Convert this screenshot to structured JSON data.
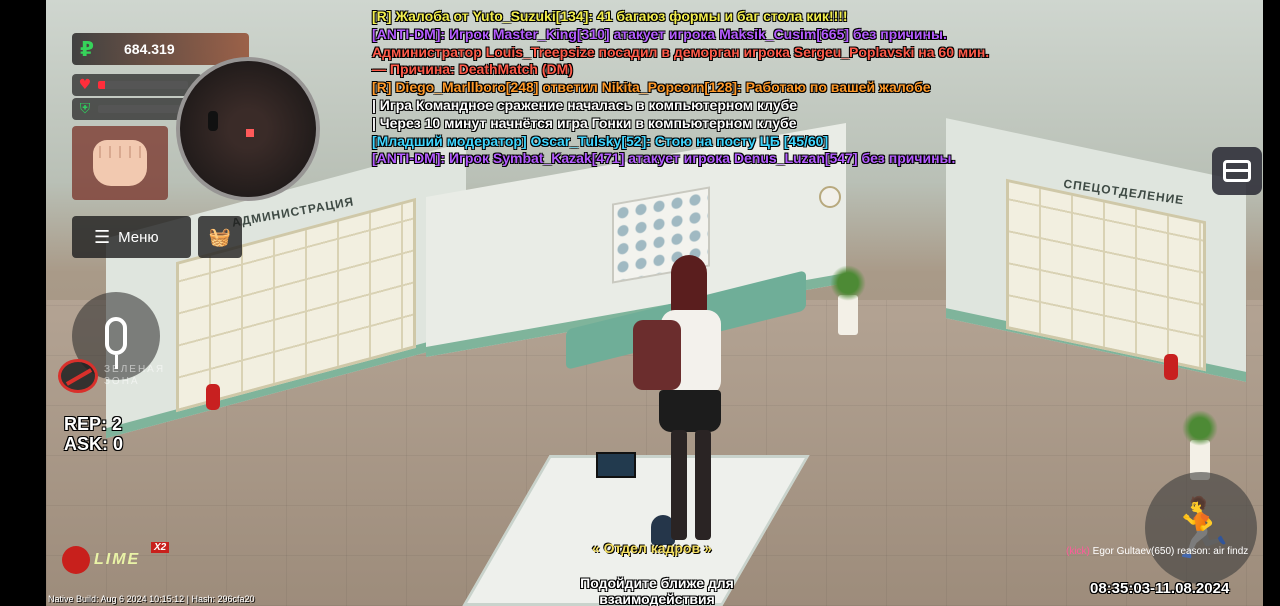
{
  "hud": {
    "money": "684.319",
    "currency_icon": "ruble-icon",
    "health_fraction": 0.08,
    "armor_fraction": 0.0,
    "health_color": "#ff2d3b",
    "armor_color": "#2fcf5e",
    "weapon_icon": "fist-icon",
    "menu_label": "Меню",
    "menu_icon": "hamburger-icon",
    "shop_icon": "basket-icon",
    "mic_icon": "microphone-icon",
    "zone_label": "ЗЕЛЕНАЯ ЗОНА",
    "rep": "REP: 2",
    "ask": "ASK: 0"
  },
  "scene": {
    "sign_left": "АДМИНИСТРАЦИЯ",
    "sign_right": "СПЕЦОТДЕЛЕНИЕ",
    "npc_label": "« Отдел кадров »",
    "hint": "Подойдите ближе для взаимодействия"
  },
  "chat": [
    {
      "text": "[R] Жалоба от Yuto_Suzuki[134]: 41 багаюз формы и баг стола кик!!!!",
      "color": "#f2ee4e"
    },
    {
      "text": "[ANTI-DM]: Игрок Master_King[310] атакует игрока Maksik_Cusim[665] без причины.",
      "color": "#b45cff"
    },
    {
      "text": "Администратор Louis_Treepsize посадил в деморган игрока Sergeu_Poplavski на 60 мин.",
      "color": "#ff5b4a"
    },
    {
      "text": "—  Причина: DeathMatch (DM)",
      "color": "#ff5b4a"
    },
    {
      "text": "[R] Diego_Marllboro[248] ответил Nikita_Popcorn[128]: Работаю по вашей жалобе",
      "color": "#ff9a2a"
    },
    {
      "text": "| Игра Командное сражение началась в компьютерном клубе",
      "color": "#ffffff"
    },
    {
      "text": "| Через 10 минут начнётся игра Гонки в компьютерном клубе",
      "color": "#ffffff"
    },
    {
      "text": "[Младший модератор] Oscar_Tulsky[52]: Стою на посту ЦБ [45/60]",
      "color": "#3fd6ff"
    },
    {
      "text": "[ANTI-DM]: Игрок Symbat_Kazak[471] атакует игрока Denus_Luzan[547] без причины.",
      "color": "#b45cff"
    }
  ],
  "right": {
    "inventory_icon": "chest-icon",
    "run_icon": "running-man-icon",
    "kick_tag": "(kick)",
    "kick_text": "Egor Gultaev(650) reason: air findz",
    "timestamp": "08:35:03-11.08.2024"
  },
  "logo": {
    "text": "LIME",
    "badge": "X2"
  },
  "build_info": "Native Build: Aug  6 2024 10:15:12 | Hash: 296cfa20"
}
